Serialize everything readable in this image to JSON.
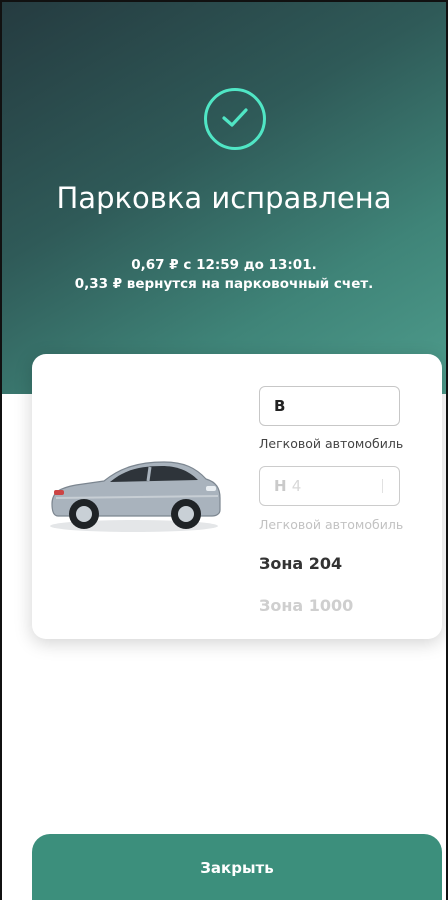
{
  "status": {
    "icon": "check-circle-icon",
    "title": "Парковка исправлена",
    "line1": "0,67 ₽ с 12:59 до 13:01.",
    "line2": "0,33 ₽ вернутся на парковочный счет."
  },
  "vehicles": [
    {
      "plate": "В",
      "type": "Легковой автомобиль"
    },
    {
      "plate": "Н",
      "plate_tail": "4",
      "type": "Легковой автомобиль"
    }
  ],
  "zones": [
    {
      "label": "Зона 204"
    },
    {
      "label": "Зона 1000"
    }
  ],
  "car_image": {
    "icon": "sedan-car-icon",
    "color": "#a9b3bd"
  },
  "actions": {
    "close_label": "Закрыть"
  },
  "colors": {
    "accent": "#50e6c5",
    "button": "#3c8f7c",
    "hero_dark": "#253b40",
    "hero_light": "#4e9c8c"
  }
}
